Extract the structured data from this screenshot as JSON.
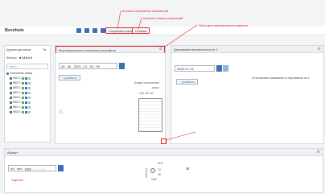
{
  "header": {
    "title": "Borehole",
    "save_label": "Сохранить панель",
    "cancel_label": "Отмена"
  },
  "annotations": {
    "save": "Кнопка сохранения изменений",
    "cancel": "Кнопка отмены изменений",
    "drag": "Поле для перемещения виджета",
    "resize": "Кнопка изменения размеров виджета"
  },
  "tree_panel": {
    "title": "Дерево датчиков",
    "sort": "Ти",
    "filter_label": "Фильтр",
    "count_value": "418",
    "search_placeholder": "Найти",
    "root_label": "Отклонение сквазу",
    "items": [
      {
        "name": "WD1",
        "value": "1"
      },
      {
        "name": "WD2",
        "value": "1"
      },
      {
        "name": "WD3",
        "value": "1"
      },
      {
        "name": "WD4",
        "value": "1"
      },
      {
        "name": "WD5",
        "value": "1"
      },
      {
        "name": "WD6",
        "value": "1"
      },
      {
        "name": "WD7",
        "value": "1"
      },
      {
        "name": "WD8",
        "value": "1"
      }
    ]
  },
  "panel_inclin": {
    "title": "Вертикальность отношения устройств",
    "datetime": "28 . 06 . 2023 , 21 : 52 : 05",
    "add_label": "+ Добавить",
    "gauge_title": "Азимут отклонения",
    "gauge_unit": "класс",
    "scale_ticks": [
      "-100",
      "-50",
      "-40"
    ]
  },
  "panel_diagram": {
    "title": "Диаграмма вертикальности 2",
    "date": "2023-07-13",
    "add_label": "+ Добавить",
    "side_label": "Отклонение скважины от вертикали по с"
  },
  "panel_azimuth": {
    "title": "Азимут",
    "datetime": "dd . mm . yyyy , -- : -- : --",
    "add_label": "Закрытие",
    "compass_top": "315°",
    "compass_mid": "10",
    "compass_low": "90",
    "compass_bottom": "135°",
    "compass_axis": "Секция"
  },
  "colors": {
    "accent": "#3c6fb4",
    "annot": "#e0262a",
    "header_bg": "#eef0f3"
  }
}
